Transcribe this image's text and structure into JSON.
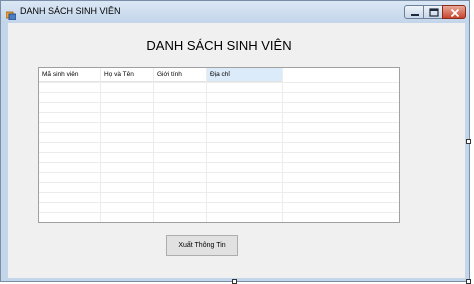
{
  "window": {
    "title": "DANH SÁCH SINH VIÊN"
  },
  "form": {
    "heading": "DANH SÁCH SINH VIÊN"
  },
  "grid": {
    "columns": [
      "Mã sinh viên",
      "Họ và Tên",
      "Giới tính",
      "Địa chỉ"
    ],
    "selected_column": "Địa chỉ",
    "rows": []
  },
  "actions": {
    "export_label": "Xuất Thông Tin"
  }
}
